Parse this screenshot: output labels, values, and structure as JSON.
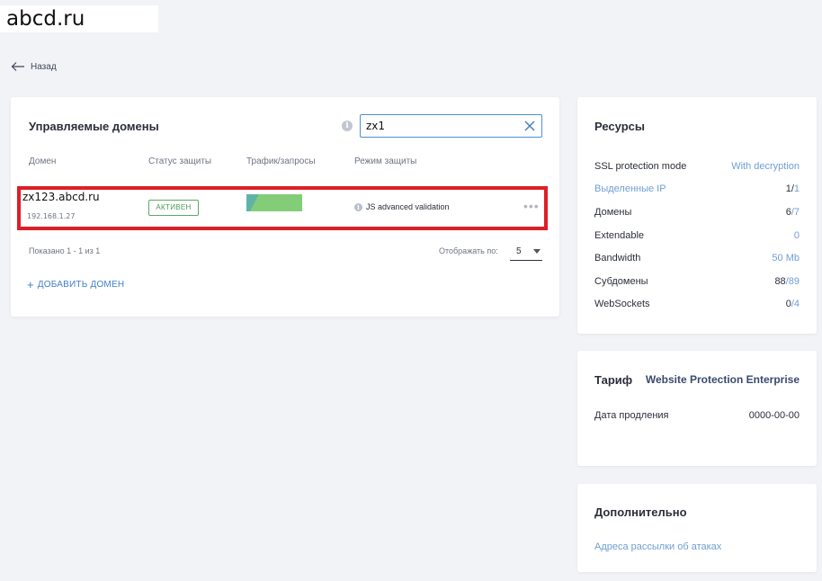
{
  "site": {
    "label": "abcd.ru"
  },
  "nav": {
    "back_label": "Назад"
  },
  "domains": {
    "title": "Управляемые домены",
    "search": {
      "value": "zx1",
      "placeholder": ""
    },
    "columns": [
      "Домен",
      "Статус защиты",
      "Трафик/запросы",
      "Режим защиты"
    ],
    "rows": [
      {
        "domain": "zx123.abcd.ru",
        "ip": "192.168.1.27",
        "status": "АКТИВЕН",
        "mode": "JS advanced validation"
      }
    ],
    "shown_text": "Показано 1 - 1 из 1",
    "per_page_label": "Отображать по:",
    "per_page_value": "5",
    "add_label": "ДОБАВИТЬ ДОМЕН"
  },
  "resources": {
    "title": "Ресурсы",
    "items": [
      {
        "label": "SSL protection mode",
        "value": "With decryption"
      },
      {
        "label": "Выделенные IP",
        "used": "1",
        "total": "1"
      },
      {
        "label": "Домены",
        "used": "6",
        "total": "7"
      },
      {
        "label": "Extendable",
        "value": "0"
      },
      {
        "label": "Bandwidth",
        "value": "50 Mb"
      },
      {
        "label": "Субдомены",
        "used": "88",
        "total": "89"
      },
      {
        "label": "WebSockets",
        "used": "0",
        "total": "4"
      }
    ]
  },
  "tariff": {
    "title": "Тариф",
    "plan": "Website Protection Enterprise",
    "renewal_label": "Дата продления",
    "renewal_value": "0000-00-00"
  },
  "extra": {
    "title": "Дополнительно",
    "attack_link": "Адреса рассылки об атаках"
  },
  "colors": {
    "accent": "#3f7fcc",
    "link": "#6f9fd4",
    "highlight": "#dd1f26",
    "active": "#5aa866",
    "traffic": "#82cb7a"
  },
  "icons": {
    "back": "arrow-left-icon",
    "info": "info-icon",
    "clear": "close-icon",
    "more": "more-dots-icon",
    "add": "plus-icon"
  }
}
